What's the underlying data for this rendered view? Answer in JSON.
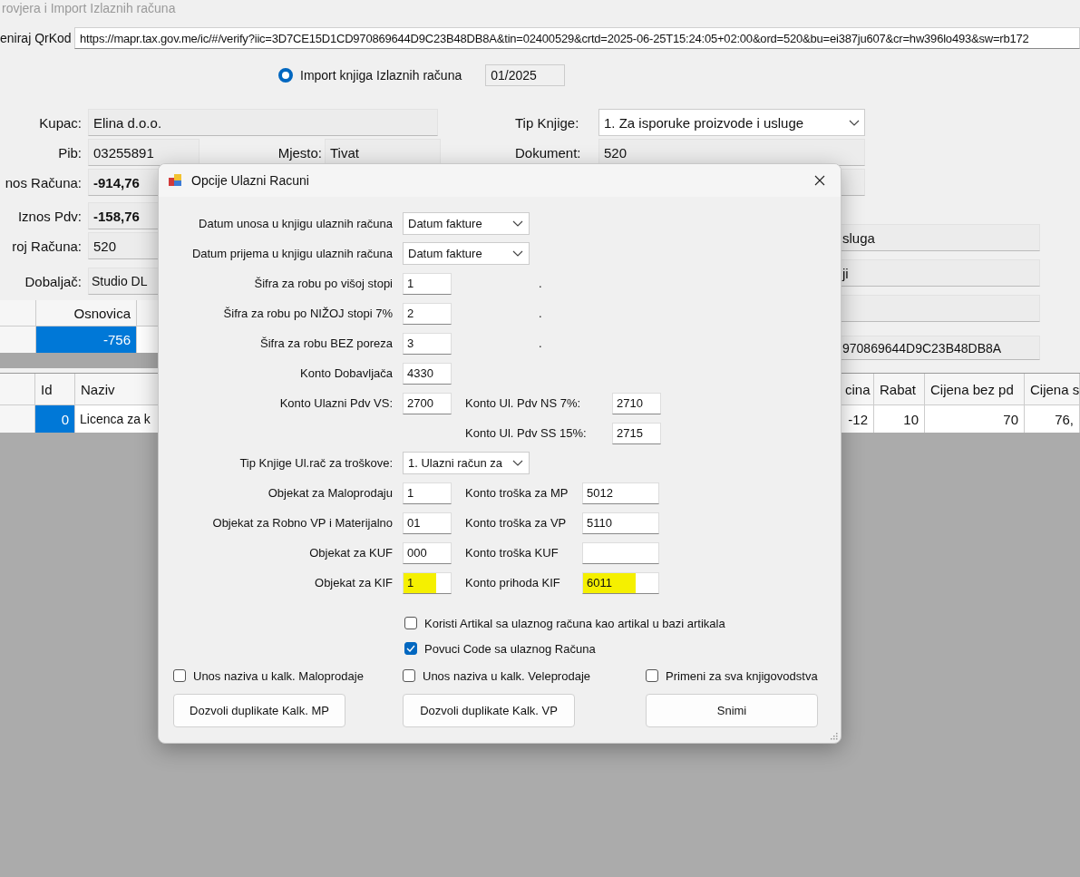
{
  "window": {
    "title": "rovjera i Import Izlaznih računa"
  },
  "qr": {
    "label": "eniraj QrKod",
    "url": "https://mapr.tax.gov.me/ic/#/verify?iic=3D7CE15D1CD970869644D9C23B48DB8A&tin=02400529&crtd=2025-06-25T15:24:05+02:00&ord=520&bu=ei387ju607&cr=hw396lo493&sw=rb172"
  },
  "import": {
    "label": "Import knjiga Izlaznih računa",
    "selected": true,
    "period": "01/2025"
  },
  "invoice": {
    "kupac": {
      "label": "Kupac:",
      "value": "Elina d.o.o."
    },
    "pib": {
      "label": "Pib:",
      "value": "03255891"
    },
    "mjesto": {
      "label": "Mjesto:",
      "value": "Tivat"
    },
    "amounts": [
      {
        "label": "nos Računa:",
        "value": "-914,76"
      },
      {
        "label": "Iznos Pdv:",
        "value": "-158,76"
      }
    ],
    "broj": {
      "label": "roj Računa:",
      "value": "520"
    },
    "dobavljac": {
      "label": "Dobaljač:",
      "value": "Studio DL"
    },
    "tip_knjige": {
      "label": "Tip Knjige:",
      "value": "1. Za isporuke proizvode i usluge"
    },
    "dokument": {
      "label": "Dokument:",
      "value": "520"
    },
    "right_fields": [
      "sluga",
      "ji",
      "970869644D9C23B48DB8A"
    ]
  },
  "summary_grid": {
    "columns": [
      "Osnovica"
    ],
    "rows": [
      {
        "cells": [
          "-756"
        ],
        "selected": true
      }
    ]
  },
  "items_grid": {
    "columns": [
      "Id",
      "Naziv",
      "cina",
      "Rabat",
      "Cijena bez pd",
      "Cijena s"
    ],
    "rows": [
      {
        "cells": [
          "0",
          "Licenca za k",
          "-12",
          "10",
          "70",
          "76,"
        ],
        "selected": true
      }
    ]
  },
  "dialog": {
    "title": "Opcije Ulazni Racuni",
    "rows": [
      {
        "kind": "select",
        "label": "Datum unosa u knjigu ulaznih računa",
        "value": "Datum fakture"
      },
      {
        "kind": "select",
        "label": "Datum prijema u knjigu ulaznih računa",
        "value": "Datum fakture"
      },
      {
        "kind": "code",
        "label": "Šifra za robu po višoj stopi",
        "value": "1",
        "highlighted": false,
        "note": "."
      },
      {
        "kind": "code",
        "label": "Šifra za robu po NIŽOJ stopi 7%",
        "value": "2",
        "highlighted": false,
        "note": "."
      },
      {
        "kind": "code",
        "label": "Šifra za robu BEZ poreza",
        "value": "3",
        "highlighted": false,
        "note": "."
      },
      {
        "kind": "input",
        "label": "Konto Dobavljača",
        "value": "4330",
        "highlighted": false
      },
      {
        "kind": "vat",
        "label": "Konto Ulazni Pdv VS:",
        "value": "2700",
        "highlighted": false,
        "label2": "Konto Ul. Pdv NS 7%:",
        "value2": "2710",
        "highlighted2": false
      },
      {
        "kind": "vat_only",
        "label2": "Konto Ul. Pdv SS 15%:",
        "value2": "2715",
        "highlighted2": false
      },
      {
        "kind": "select",
        "label": "Tip Knjige Ul.rač za troškove:",
        "value": "1. Ulazni račun za"
      },
      {
        "kind": "pair",
        "label": "Objekat za Maloprodaju",
        "value": "1",
        "highlighted": false,
        "label2": "Konto troška za MP",
        "value2": "5012",
        "highlighted2": false
      },
      {
        "kind": "pair",
        "label": "Objekat za Robno VP i Materijalno",
        "value": "01",
        "highlighted": false,
        "label2": "Konto troška za VP",
        "value2": "5110",
        "highlighted2": false
      },
      {
        "kind": "pair",
        "label": "Objekat za KUF",
        "value": "000",
        "highlighted": false,
        "label2": "Konto troška KUF",
        "highlighted2": false
      },
      {
        "kind": "pair",
        "label": "Objekat za KIF",
        "value": "1",
        "highlighted": true,
        "label2": "Konto prihoda KIF",
        "value2": "6011",
        "highlighted2": true
      }
    ],
    "options": [
      {
        "label": "Koristi Artikal sa ulaznog računa kao artikal u bazi artikala",
        "checked": false
      },
      {
        "label": "Povuci Code sa ulaznog Računa",
        "checked": true
      }
    ],
    "bottom_options": [
      {
        "label": "Unos naziva u kalk. Maloprodaje",
        "checked": false
      },
      {
        "label": "Unos naziva u kalk. Veleprodaje",
        "checked": false
      },
      {
        "label": "Primeni za sva knjigovodstva",
        "checked": false
      }
    ],
    "buttons": [
      "Dozvoli duplikate Kalk. MP",
      "Dozvoli duplikate Kalk. VP",
      "Snimi"
    ]
  }
}
